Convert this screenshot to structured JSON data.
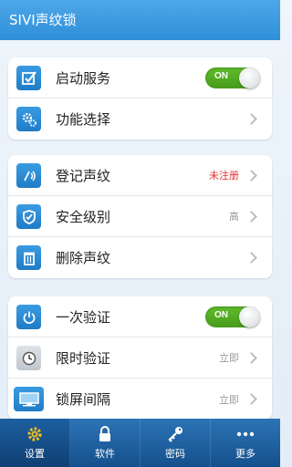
{
  "app": {
    "title": "SIVI声纹锁"
  },
  "groups": [
    {
      "rows": [
        {
          "label": "启动服务",
          "toggle": "ON",
          "icon": "checkbox-icon"
        },
        {
          "label": "功能选择",
          "icon": "gears-icon"
        }
      ]
    },
    {
      "rows": [
        {
          "label": "登记声纹",
          "value": "未注册",
          "icon": "voice-register-icon"
        },
        {
          "label": "安全级别",
          "value": "高",
          "icon": "shield-icon"
        },
        {
          "label": "删除声纹",
          "icon": "trash-icon"
        }
      ]
    },
    {
      "rows": [
        {
          "label": "一次验证",
          "toggle": "ON",
          "icon": "power-icon"
        },
        {
          "label": "限时验证",
          "value": "立即",
          "icon": "clock-icon"
        },
        {
          "label": "锁屏间隔",
          "value": "立即",
          "icon": "monitor-icon"
        }
      ]
    }
  ],
  "tabs": [
    {
      "label": "设置",
      "icon": "gear-icon",
      "active": true
    },
    {
      "label": "软件",
      "icon": "lock-icon"
    },
    {
      "label": "密码",
      "icon": "key-icon"
    },
    {
      "label": "更多",
      "icon": "more-icon"
    }
  ],
  "colors": {
    "accent": "#2f8fd8",
    "toggle_on": "#5fbb2a",
    "warning": "#e03030",
    "tabbar": "#15508d"
  }
}
